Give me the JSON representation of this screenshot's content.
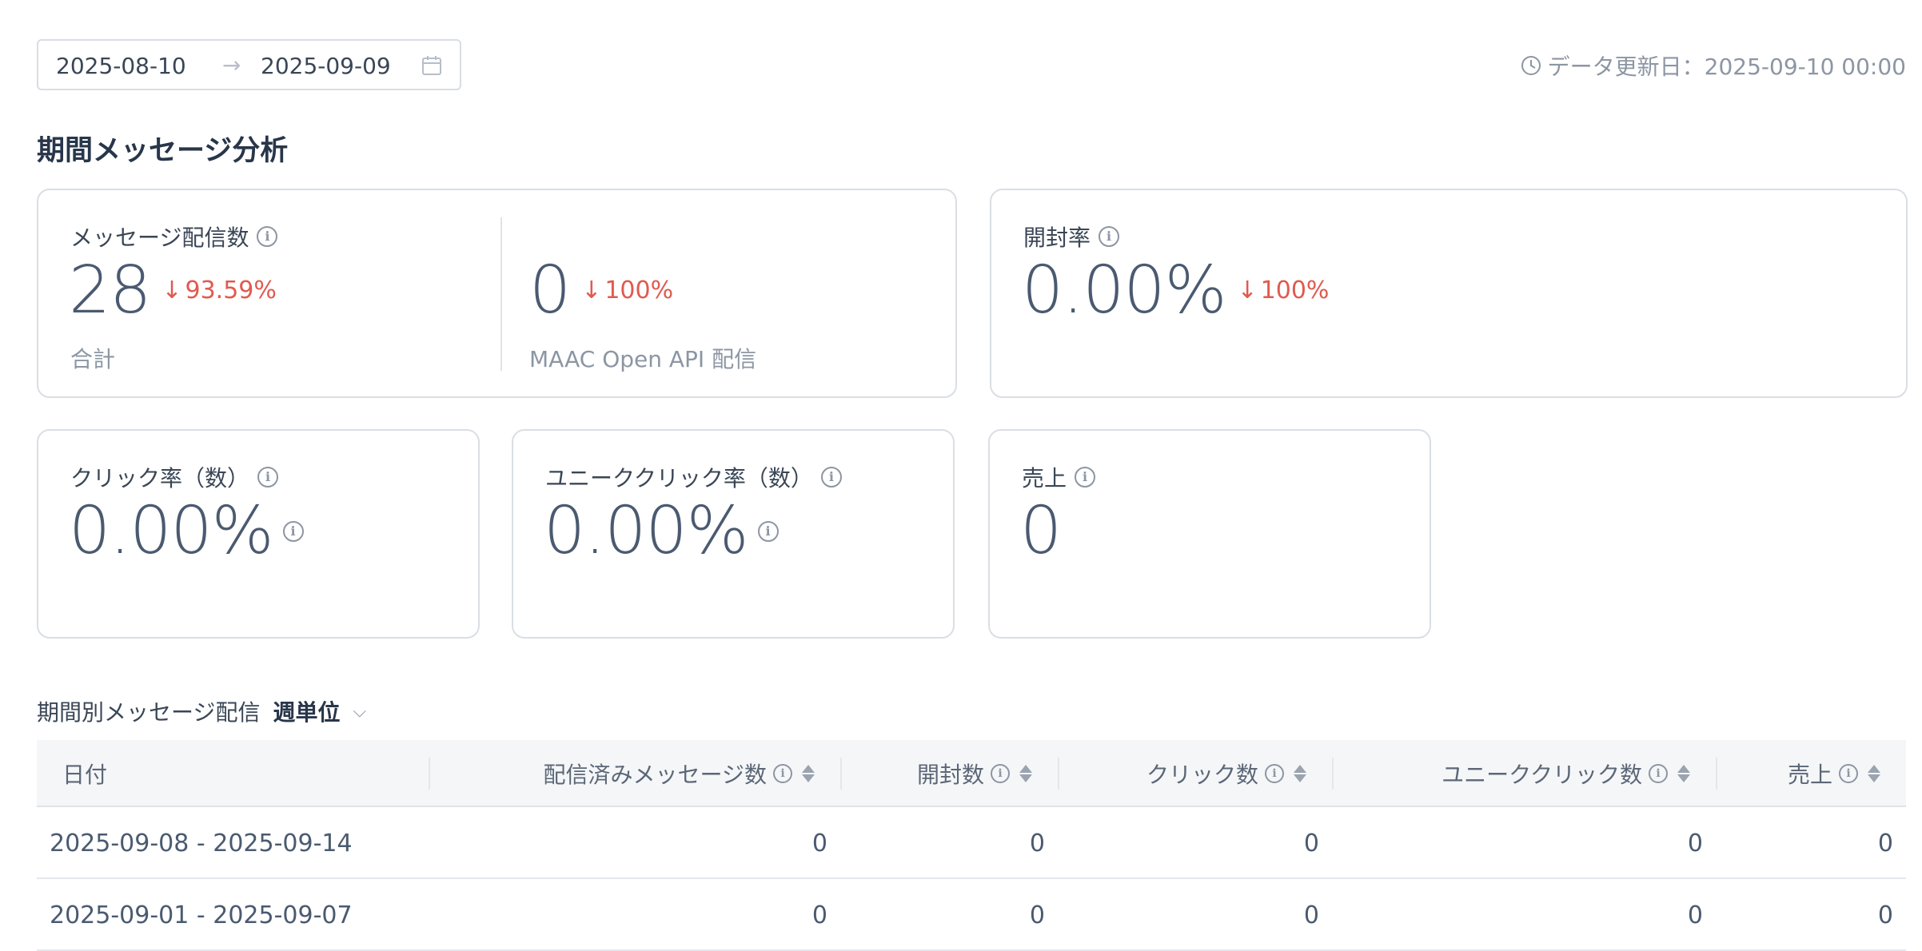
{
  "date_range": {
    "start": "2025-08-10",
    "end": "2025-09-09"
  },
  "updated_label": "データ更新日：2025-09-10 00:00",
  "section_title": "期間メッセージ分析",
  "cards": {
    "delivery": {
      "label": "メッセージ配信数",
      "total_value": "28",
      "total_change": "93.59%",
      "total_sub": "合計",
      "api_value": "0",
      "api_change": "100%",
      "api_sub": "MAAC Open API 配信"
    },
    "open_rate": {
      "label": "開封率",
      "value": "0.00%",
      "change": "100%"
    },
    "click_rate": {
      "label": "クリック率（数）",
      "value": "0.00%"
    },
    "unique_click_rate": {
      "label": "ユニーククリック率（数）",
      "value": "0.00%"
    },
    "sales": {
      "label": "売上",
      "value": "0"
    }
  },
  "table": {
    "title": "期間別メッセージ配信",
    "unit": "週単位",
    "columns": [
      "日付",
      "配信済みメッセージ数",
      "開封数",
      "クリック数",
      "ユニーククリック数",
      "売上"
    ],
    "rows": [
      [
        "2025-09-08 - 2025-09-14",
        "0",
        "0",
        "0",
        "0",
        "0"
      ],
      [
        "2025-09-01 - 2025-09-07",
        "0",
        "0",
        "0",
        "0",
        "0"
      ]
    ]
  },
  "colors": {
    "decrease": "#e05a4f",
    "text": "#4a5a70",
    "muted": "#8c96a3"
  }
}
